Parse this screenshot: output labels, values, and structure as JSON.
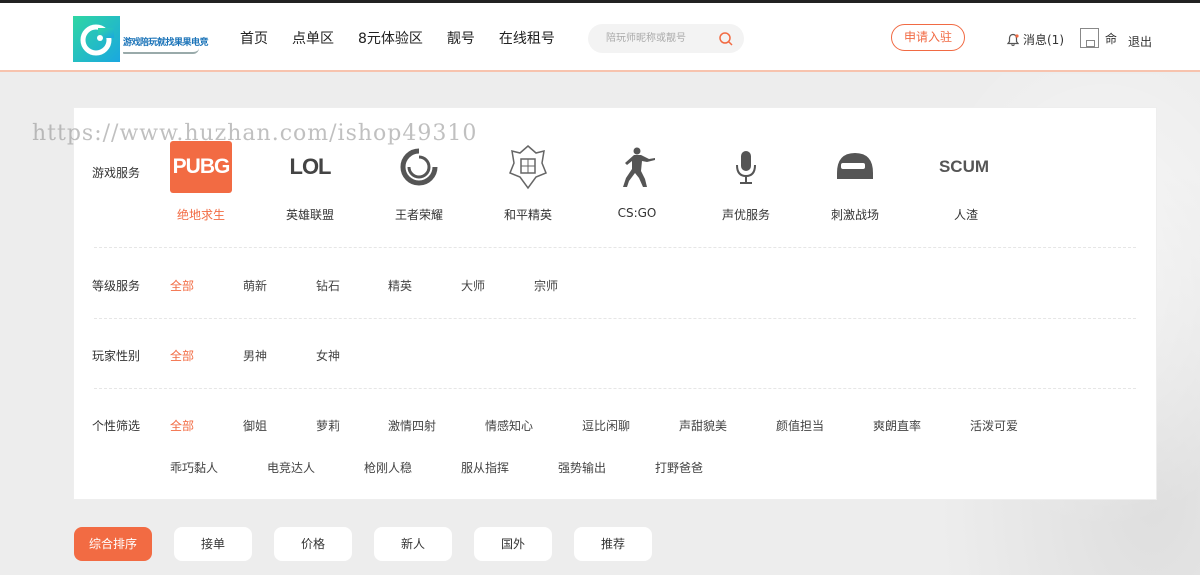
{
  "header": {
    "logo_text": "游戏陪玩就找果果电竞",
    "nav": [
      "首页",
      "点单区",
      "8元体验区",
      "靓号",
      "在线租号"
    ],
    "search_placeholder": "陪玩师昵称或靓号",
    "apply_label": "申请入驻",
    "messages_label": "消息(1)",
    "user_name": "命",
    "logout_label": "退出"
  },
  "watermark": "https://www.huzhan.com/ishop49310",
  "filters": {
    "games": {
      "label": "游戏服务",
      "items": [
        {
          "name": "绝地求生",
          "icon": "pubg-icon",
          "icon_text": "PUBG"
        },
        {
          "name": "英雄联盟",
          "icon": "lol-icon",
          "icon_text": "LOL"
        },
        {
          "name": "王者荣耀",
          "icon": "honor-of-kings-icon",
          "icon_text": ""
        },
        {
          "name": "和平精英",
          "icon": "peace-elite-icon",
          "icon_text": ""
        },
        {
          "name": "CS:GO",
          "icon": "csgo-icon",
          "icon_text": ""
        },
        {
          "name": "声优服务",
          "icon": "microphone-icon",
          "icon_text": ""
        },
        {
          "name": "刺激战场",
          "icon": "helmet-icon",
          "icon_text": ""
        },
        {
          "name": "人渣",
          "icon": "scum-icon",
          "icon_text": "SCUM"
        }
      ]
    },
    "level": {
      "label": "等级服务",
      "options": [
        "全部",
        "萌新",
        "钻石",
        "精英",
        "大师",
        "宗师"
      ]
    },
    "gender": {
      "label": "玩家性别",
      "options": [
        "全部",
        "男神",
        "女神"
      ]
    },
    "personality": {
      "label": "个性筛选",
      "row1": [
        "全部",
        "御姐",
        "萝莉",
        "激情四射",
        "情感知心",
        "逗比闲聊",
        "声甜貌美",
        "颜值担当",
        "爽朗直率",
        "活泼可爱"
      ],
      "row2": [
        "乖巧黏人",
        "电竞达人",
        "枪刚人稳",
        "服从指挥",
        "强势输出",
        "打野爸爸"
      ]
    }
  },
  "sort": [
    "综合排序",
    "接单",
    "价格",
    "新人",
    "国外",
    "推荐"
  ],
  "colors": {
    "accent": "#f26b43",
    "logo_gradient_start": "#2fd6a3",
    "logo_gradient_end": "#1aa7e0"
  }
}
